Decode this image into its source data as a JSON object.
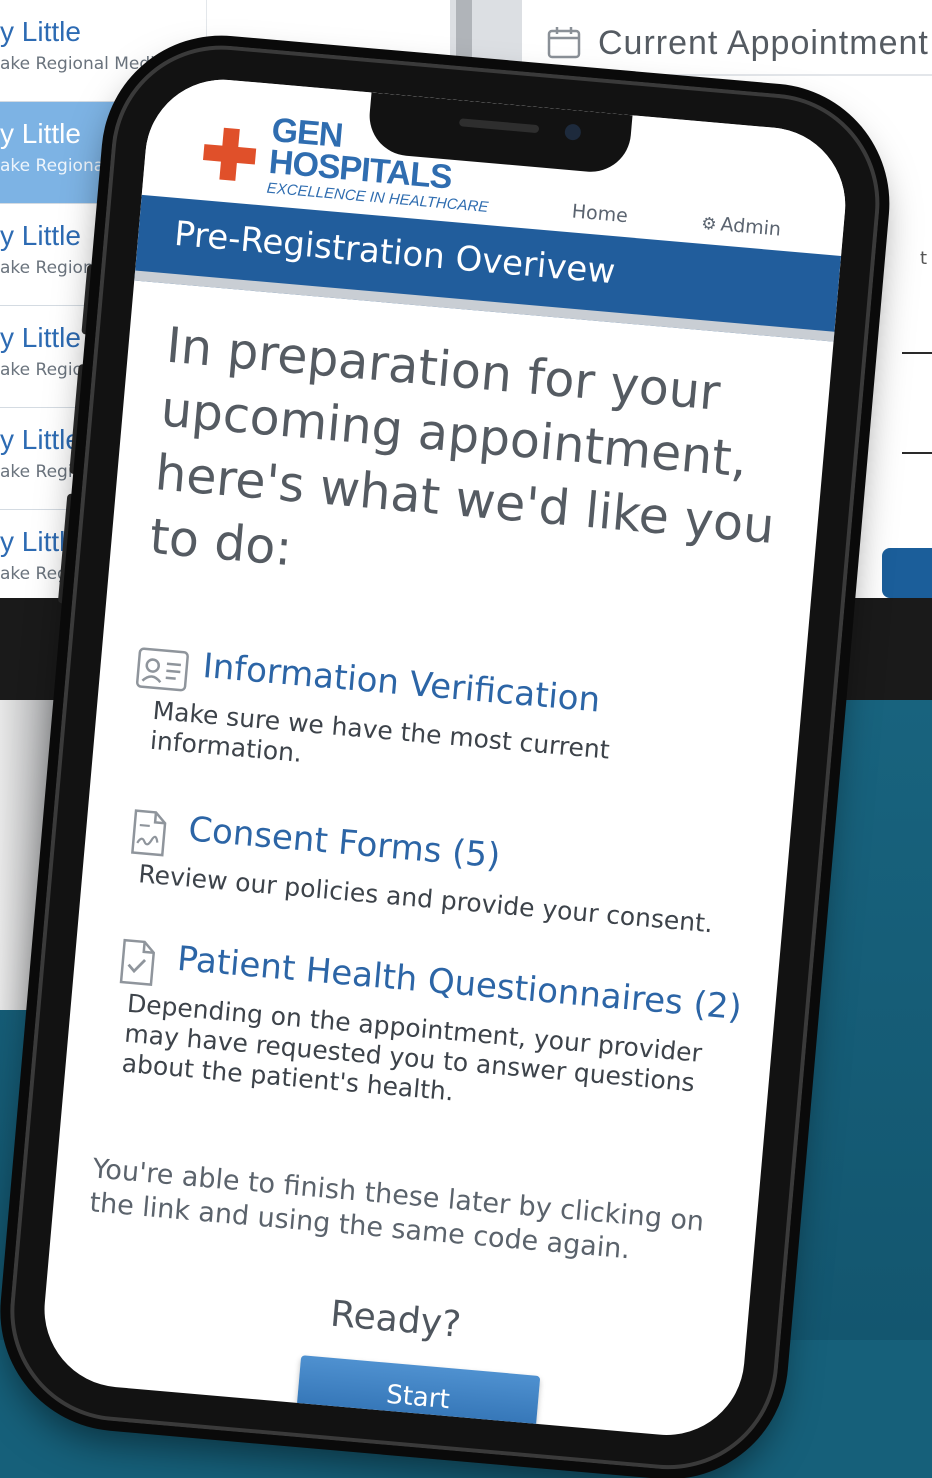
{
  "background": {
    "list_rows": [
      {
        "name": "y Little",
        "sub": "ake Regional Medical"
      },
      {
        "name": "y Little",
        "sub": "ake Regional Medic"
      },
      {
        "name": "y Little",
        "sub": "ake Regional Medi"
      },
      {
        "name": "y Little",
        "sub": "ake Regional Me"
      },
      {
        "name": "y Little",
        "sub": "ake Regional M"
      },
      {
        "name": "y Little",
        "sub": "ake Regional"
      }
    ],
    "selected_row_index": 1,
    "appointment_title": "Current Appointment",
    "right_fragment": "t"
  },
  "phone": {
    "logo": {
      "line1": "GEN",
      "line2": "HOSPITALS",
      "tagline": "EXCELLENCE IN HEALTHCARE"
    },
    "nav": {
      "home": "Home",
      "admin": "Admin"
    },
    "page_title": "Pre-Registration Overivew",
    "intro": "In preparation for your upcoming appointment, here's what we'd like you to do:",
    "tasks": [
      {
        "icon": "id-card-icon",
        "title": "Information Verification",
        "description": "Make sure we have the most current information."
      },
      {
        "icon": "document-signature-icon",
        "title": "Consent Forms (5)",
        "description": "Review our policies and provide your consent."
      },
      {
        "icon": "checklist-document-icon",
        "title": "Patient Health Questionnaires (2)",
        "description": "Depending on the appointment, your provider may have requested you to answer questions about the patient's health."
      }
    ],
    "note": "You're able to finish these later by clicking on the link and using the same code again.",
    "ready": "Ready?",
    "start_label": "Start"
  },
  "colors": {
    "brand_blue": "#215d9c",
    "logo_cross": "#e0502a",
    "link_blue": "#2c65a6",
    "background_teal": "#16607a"
  }
}
